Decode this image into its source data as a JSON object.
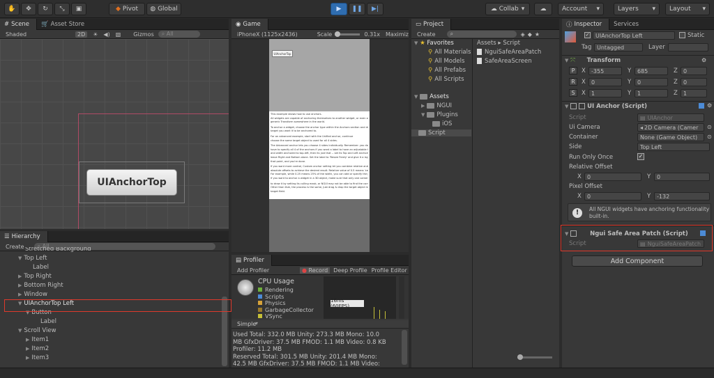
{
  "toolbar": {
    "pivot": "Pivot",
    "global": "Global",
    "collab": "Collab",
    "account": "Account",
    "layers": "Layers",
    "layout": "Layout"
  },
  "scene": {
    "tab": "Scene",
    "tab2": "Asset Store",
    "shaded": "Shaded",
    "mode2d": "2D",
    "gizmos": "Gizmos",
    "search": "All",
    "button_label": "UIAnchorTop"
  },
  "game": {
    "tab": "Game",
    "resolution": "iPhoneX (1125x2436)",
    "scale_label": "Scale",
    "scale_value": "0.31x",
    "maximize": "Maximiz",
    "button_label": "UIAnchorTop",
    "body_lines": [
      "This example shows how to use anchors.",
      "All widgets are capable of anchoring themselves to another widget, or even a",
      "generic Transform somewhere in the world.",
      "To anchor a widget, choose the anchor type within the Anchors section and drag a",
      "target you want it to be anchored to.",
      "For an advanced example, start with the Unified anchor, continue",
      "choose the same target object to used for all 4 sides.",
      "The Advanced anchor lets you choose 4 sides individually. Remember: you don't",
      "have to specify all 4 of the anchors if you want a label to have an adjustable height",
      "and width anchored to top-left, then its just that -- set its Top and Left anchors, but",
      "leave Right and Bottom alone. Set the label to 'Resize Freely' and give it a layout",
      "that point, and you're done.",
      "If you want more control, Custom anchor setting let you combine relative and",
      "absolute offsets to achieve the desired result. Relative value of 0.5 means 'center'.",
      "For example, while 0.25 means 25% of the width, you can add or specify the pivot point.",
      "If you want to anchor a widget in a 3D object, make sure that only one camera is used",
      "to draw it by setting its culling mask, or NGUI may not be able to find the correct camera.",
      "Other than that, the process is the same, just drag & drop the target object into the",
      "target field."
    ]
  },
  "project": {
    "tab": "Project",
    "create": "Create",
    "favorites": "Favorites",
    "fav_items": [
      "All Materials",
      "All Models",
      "All Prefabs",
      "All Scripts"
    ],
    "assets": "Assets",
    "asset_items": [
      "NGUI",
      "Plugins",
      "iOS",
      "Script"
    ],
    "breadcrumb_root": "Assets",
    "breadcrumb_sep": "▸",
    "breadcrumb_leaf": "Script",
    "files": [
      "NguiSafeAreaPatch",
      "SafeAreaScreen"
    ]
  },
  "inspector": {
    "tab": "Inspector",
    "tab2": "Services",
    "object_name": "UIAnchorTop Left",
    "static": "Static",
    "tag_label": "Tag",
    "tag_value": "Untagged",
    "layer_label": "Layer",
    "transform": {
      "title": "Transform",
      "p": "P",
      "r": "R",
      "s": "S",
      "x": "X",
      "y": "Y",
      "z": "Z",
      "pos": [
        "-355",
        "685",
        "0"
      ],
      "rot": [
        "0",
        "0",
        "0"
      ],
      "scale": [
        "1",
        "1",
        "1"
      ]
    },
    "anchor": {
      "title": "UI Anchor (Script)",
      "script_label": "Script",
      "script_value": "UIAnchor",
      "camera_label": "Ui Camera",
      "camera_value": "2D Camera (Camer",
      "container_label": "Container",
      "container_value": "None (Game Object)",
      "side_label": "Side",
      "side_value": "Top Left",
      "run_once_label": "Run Only Once",
      "rel_offset_label": "Relative Offset",
      "rel_x": "0",
      "rel_y": "0",
      "pix_offset_label": "Pixel Offset",
      "pix_x": "0",
      "pix_y": "-132",
      "note": "All NGUI widgets have anchoring functionality built-in."
    },
    "patch": {
      "title": "Ngui Safe Area Patch (Script)",
      "script_label": "Script",
      "script_value": "NguiSafeAreaPatch"
    },
    "add_component": "Add Component"
  },
  "hierarchy": {
    "tab": "Hierarchy",
    "create": "Create",
    "search": "All",
    "items": [
      {
        "label": "Stretched Background",
        "indent": 1,
        "arrow": ""
      },
      {
        "label": "Top Left",
        "indent": 1,
        "arrow": "▼"
      },
      {
        "label": "Label",
        "indent": 2,
        "arrow": ""
      },
      {
        "label": "Top Right",
        "indent": 1,
        "arrow": "▶"
      },
      {
        "label": "Bottom Right",
        "indent": 1,
        "arrow": "▶"
      },
      {
        "label": "Window",
        "indent": 1,
        "arrow": "▶"
      },
      {
        "label": "UIAnchorTop Left",
        "indent": 1,
        "arrow": "▼"
      },
      {
        "label": "Button",
        "indent": 2,
        "arrow": "▼"
      },
      {
        "label": "Label",
        "indent": 3,
        "arrow": ""
      },
      {
        "label": "Scroll View",
        "indent": 1,
        "arrow": "▼"
      },
      {
        "label": "Item1",
        "indent": 2,
        "arrow": "▶"
      },
      {
        "label": "Item2",
        "indent": 2,
        "arrow": "▶"
      },
      {
        "label": "Item3",
        "indent": 2,
        "arrow": "▶"
      }
    ]
  },
  "profiler": {
    "tab": "Profiler",
    "add": "Add Profiler",
    "record": "Record",
    "deep": "Deep Profile",
    "editor": "Profile Editor",
    "cpu": "CPU Usage",
    "legend": [
      "Rendering",
      "Scripts",
      "Physics",
      "GarbageCollector",
      "VSync"
    ],
    "fps": "16ms (60FPS)",
    "mode": "Simple",
    "stats": [
      "Used Total: 332.0 MB   Unity: 273.3 MB   Mono: 10.0",
      "MB   GfxDriver: 37.5 MB   FMOD: 1.1 MB   Video: 0.8 KB",
      "Profiler: 11.2 MB",
      "Reserved Total: 301.5 MB   Unity: 201.4 MB   Mono:",
      "42.5 MB   GfxDriver: 37.5 MB   FMOD: 1.1 MB   Video:"
    ]
  },
  "colors": {
    "accent": "#2f6db0",
    "highlight": "#e0392b",
    "legend": [
      "#6fb03c",
      "#4c8bd6",
      "#d7a33a",
      "#9b7a2b",
      "#c6c038"
    ]
  }
}
